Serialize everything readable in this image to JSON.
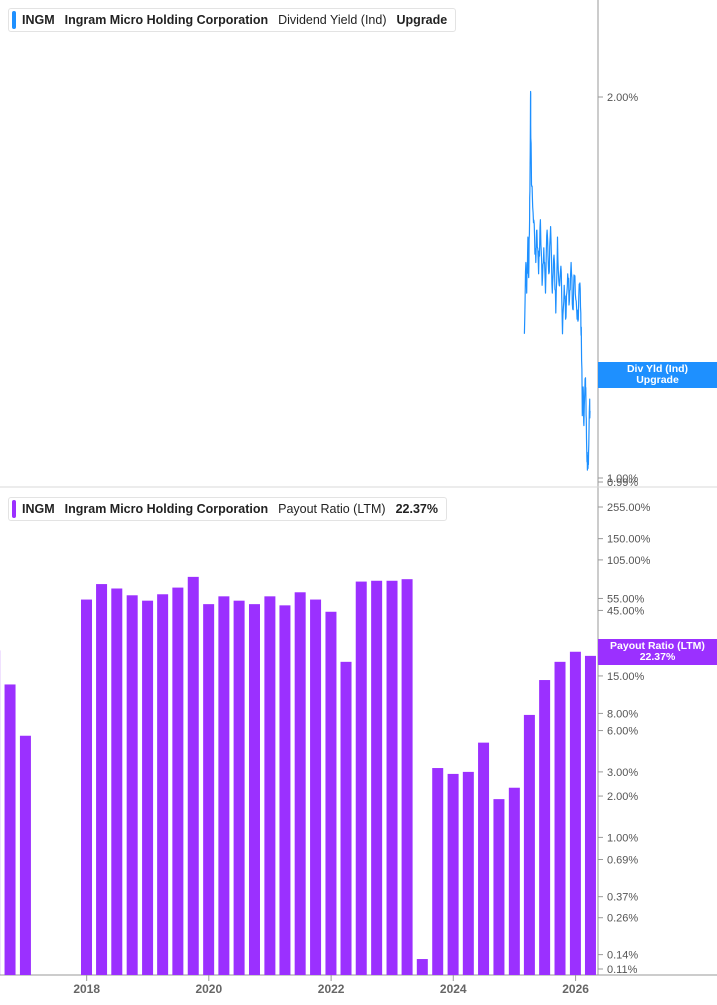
{
  "colors": {
    "dividend": "#1e90ff",
    "payout": "#9b30ff",
    "axis": "#999999",
    "grid": "#d9d9d9",
    "text": "#555555"
  },
  "top_legend": {
    "symbol": "INGM",
    "company": "Ingram Micro Holding Corporation",
    "metric": "Dividend Yield (Ind)",
    "value": "Upgrade"
  },
  "bottom_legend": {
    "symbol": "INGM",
    "company": "Ingram Micro Holding Corporation",
    "metric": "Payout Ratio (LTM)",
    "value": "22.37%"
  },
  "top_flag": {
    "line1": "Div Yld (Ind)",
    "line2": "Upgrade"
  },
  "bottom_flag": {
    "line1": "Payout Ratio (LTM)",
    "line2": "22.37%"
  },
  "chart_data": [
    {
      "type": "line",
      "series": [
        {
          "name": "Dividend Yield (Ind)",
          "x": [],
          "values": []
        }
      ],
      "yscale": "log",
      "ylim": [
        0.99,
        2.02
      ],
      "yticks": [
        {
          "label": "2.00%",
          "value": 2.0
        },
        {
          "label": "1.00%",
          "value": 1.0
        },
        {
          "label": "0.99%",
          "value": 0.99
        }
      ],
      "xlim": [
        "2016-08-01",
        "2026-05-15"
      ],
      "shape_points": [
        [
          "2025-03-01",
          1.3
        ],
        [
          "2025-03-10",
          1.48
        ],
        [
          "2025-03-15",
          1.4
        ],
        [
          "2025-03-22",
          1.55
        ],
        [
          "2025-03-27",
          1.44
        ],
        [
          "2025-04-01",
          1.6
        ],
        [
          "2025-04-05",
          1.8
        ],
        [
          "2025-04-07",
          2.02
        ],
        [
          "2025-04-09",
          1.85
        ],
        [
          "2025-04-14",
          1.7
        ],
        [
          "2025-04-22",
          1.62
        ],
        [
          "2025-05-01",
          1.55
        ],
        [
          "2025-05-08",
          1.48
        ],
        [
          "2025-05-15",
          1.57
        ],
        [
          "2025-05-25",
          1.45
        ],
        [
          "2025-06-05",
          1.6
        ],
        [
          "2025-06-15",
          1.42
        ],
        [
          "2025-06-25",
          1.52
        ],
        [
          "2025-07-05",
          1.4
        ],
        [
          "2025-07-15",
          1.57
        ],
        [
          "2025-07-25",
          1.45
        ],
        [
          "2025-08-05",
          1.58
        ],
        [
          "2025-08-15",
          1.4
        ],
        [
          "2025-08-25",
          1.5
        ],
        [
          "2025-09-05",
          1.35
        ],
        [
          "2025-09-15",
          1.55
        ],
        [
          "2025-09-25",
          1.42
        ],
        [
          "2025-10-05",
          1.47
        ],
        [
          "2025-10-15",
          1.3
        ],
        [
          "2025-10-25",
          1.42
        ],
        [
          "2025-11-05",
          1.34
        ],
        [
          "2025-11-15",
          1.45
        ],
        [
          "2025-11-25",
          1.38
        ],
        [
          "2025-12-05",
          1.48
        ],
        [
          "2025-12-15",
          1.36
        ],
        [
          "2025-12-25",
          1.44
        ],
        [
          "2026-01-05",
          1.38
        ],
        [
          "2026-01-15",
          1.33
        ],
        [
          "2026-01-25",
          1.42
        ],
        [
          "2026-02-01",
          1.35
        ],
        [
          "2026-02-05",
          1.28
        ],
        [
          "2026-02-10",
          1.12
        ],
        [
          "2026-02-15",
          1.18
        ],
        [
          "2026-02-20",
          1.1
        ],
        [
          "2026-03-01",
          1.2
        ],
        [
          "2026-03-05",
          1.12
        ],
        [
          "2026-03-10",
          1.03
        ],
        [
          "2026-03-15",
          1.02
        ],
        [
          "2026-03-20",
          1.05
        ],
        [
          "2026-03-25",
          1.14
        ],
        [
          "2026-03-28",
          1.13
        ]
      ]
    },
    {
      "type": "bar",
      "series": [
        {
          "name": "Payout Ratio (LTM)"
        }
      ],
      "yscale": "log",
      "ylim": [
        0.105,
        300
      ],
      "yticks": [
        {
          "label": "255.00%",
          "value": 255
        },
        {
          "label": "150.00%",
          "value": 150
        },
        {
          "label": "105.00%",
          "value": 105
        },
        {
          "label": "55.00%",
          "value": 55
        },
        {
          "label": "45.00%",
          "value": 45
        },
        {
          "label": "15.00%",
          "value": 15
        },
        {
          "label": "8.00%",
          "value": 8
        },
        {
          "label": "6.00%",
          "value": 6
        },
        {
          "label": "3.00%",
          "value": 3
        },
        {
          "label": "2.00%",
          "value": 2
        },
        {
          "label": "1.00%",
          "value": 1
        },
        {
          "label": "0.69%",
          "value": 0.69
        },
        {
          "label": "0.37%",
          "value": 0.37
        },
        {
          "label": "0.26%",
          "value": 0.26
        },
        {
          "label": "0.14%",
          "value": 0.14
        },
        {
          "label": "0.11%",
          "value": 0.11
        }
      ],
      "xlim": [
        "2016-08-01",
        "2026-05-15"
      ],
      "points": [
        [
          "2016-06-30",
          23
        ],
        [
          "2016-09-30",
          13
        ],
        [
          "2016-12-31",
          5.5
        ],
        [
          "2017-12-31",
          54
        ],
        [
          "2018-03-31",
          70
        ],
        [
          "2018-06-30",
          65
        ],
        [
          "2018-09-30",
          58
        ],
        [
          "2018-12-31",
          53
        ],
        [
          "2019-03-31",
          59
        ],
        [
          "2019-06-30",
          66
        ],
        [
          "2019-09-30",
          79
        ],
        [
          "2019-12-31",
          50
        ],
        [
          "2020-03-31",
          57
        ],
        [
          "2020-06-30",
          53
        ],
        [
          "2020-09-30",
          50
        ],
        [
          "2020-12-31",
          57
        ],
        [
          "2021-03-31",
          49
        ],
        [
          "2021-06-30",
          61
        ],
        [
          "2021-09-30",
          54
        ],
        [
          "2021-12-31",
          44
        ],
        [
          "2022-03-31",
          19
        ],
        [
          "2022-06-30",
          73
        ],
        [
          "2022-09-30",
          74
        ],
        [
          "2022-12-31",
          74
        ],
        [
          "2023-03-31",
          76
        ],
        [
          "2023-06-30",
          0.13
        ],
        [
          "2023-09-30",
          3.2
        ],
        [
          "2023-12-31",
          2.9
        ],
        [
          "2024-03-31",
          3.0
        ],
        [
          "2024-06-30",
          4.9
        ],
        [
          "2024-09-30",
          1.9
        ],
        [
          "2024-12-31",
          2.3
        ],
        [
          "2025-03-31",
          7.8
        ],
        [
          "2025-06-30",
          14
        ],
        [
          "2025-09-30",
          19
        ],
        [
          "2025-12-31",
          22.5
        ],
        [
          "2026-03-31",
          21
        ]
      ]
    }
  ],
  "x_axis": {
    "ticks": [
      {
        "label": "2018",
        "date": "2018-01-01"
      },
      {
        "label": "2020",
        "date": "2020-01-01"
      },
      {
        "label": "2022",
        "date": "2022-01-01"
      },
      {
        "label": "2024",
        "date": "2024-01-01"
      },
      {
        "label": "2026",
        "date": "2026-01-01"
      }
    ]
  }
}
